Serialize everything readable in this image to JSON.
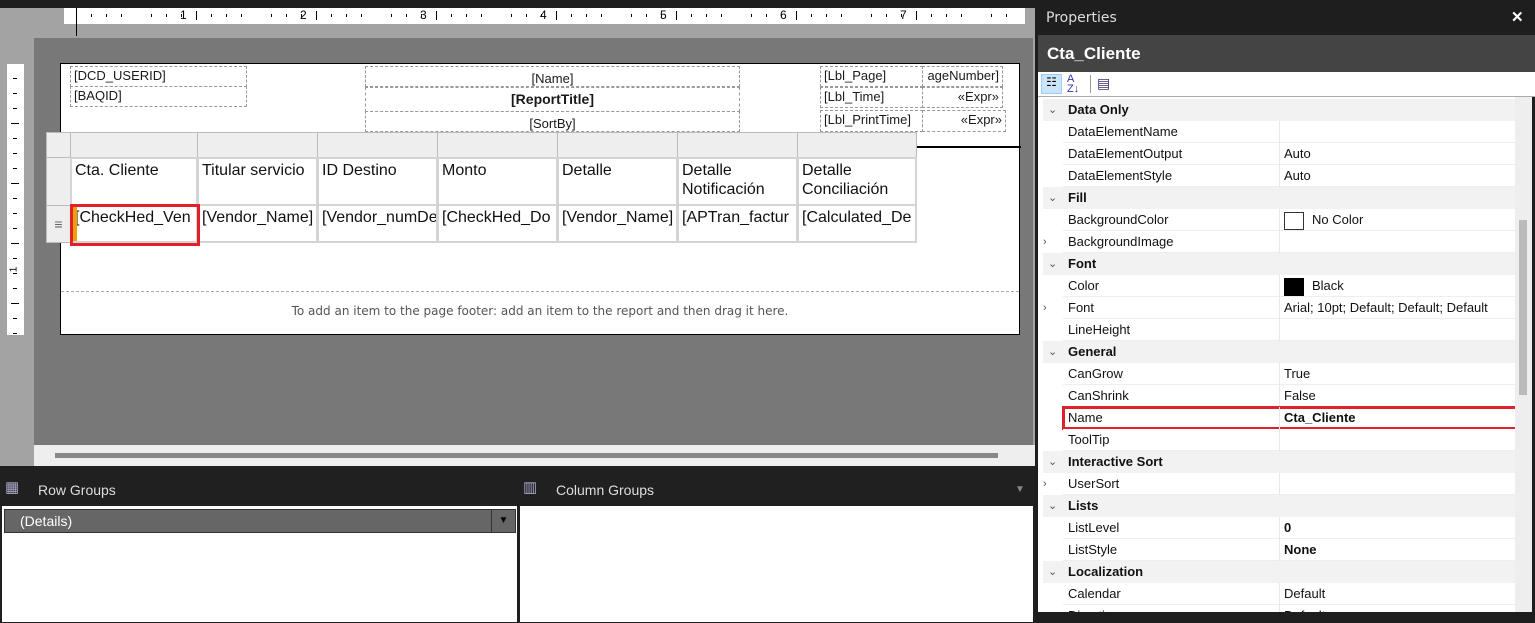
{
  "ruler": {
    "numbers": [
      "1",
      "2",
      "3",
      "4",
      "5",
      "6",
      "7"
    ],
    "vertical_number": "1"
  },
  "header": {
    "left": [
      "[DCD_USERID]",
      "[BAQID]"
    ],
    "center": [
      "[Name]",
      "[ReportTitle]",
      "[SortBy]"
    ],
    "right": [
      {
        "label": "[Lbl_Page]",
        "value": "ageNumber]"
      },
      {
        "label": "[Lbl_Time]",
        "value": "«Expr»"
      },
      {
        "label": "[Lbl_PrintTime]",
        "value": "«Expr»"
      }
    ]
  },
  "table": {
    "headers": [
      "Cta. Cliente",
      "Titular servicio",
      "ID Destino",
      "Monto",
      "Detalle",
      "Detalle Notificación",
      "Detalle Conciliación"
    ],
    "cells": [
      "[CheckHed_Ven",
      "[Vendor_Name]",
      "[Vendor_numDe",
      "[CheckHed_Do",
      "[Vendor_Name]",
      "[APTran_factur",
      "[Calculated_De"
    ],
    "row_handle": "≡"
  },
  "footer_hint": "To add an item to the page footer: add an item to the report and then drag it here.",
  "groups": {
    "row_title": "Row Groups",
    "column_title": "Column Groups",
    "row_items": [
      "(Details)"
    ]
  },
  "properties": {
    "title": "Properties",
    "close": "✕",
    "object_name": "Cta_Cliente",
    "sections": [
      {
        "name": "Data Only",
        "rows": [
          [
            "DataElementName",
            ""
          ],
          [
            "DataElementOutput",
            "Auto"
          ],
          [
            "DataElementStyle",
            "Auto"
          ]
        ]
      },
      {
        "name": "Fill",
        "rows": [
          [
            "BackgroundColor",
            "No Color"
          ],
          [
            "BackgroundImage",
            ""
          ]
        ]
      },
      {
        "name": "Font",
        "rows": [
          [
            "Color",
            "Black"
          ],
          [
            "Font",
            "Arial; 10pt; Default; Default; Default"
          ],
          [
            "LineHeight",
            ""
          ]
        ]
      },
      {
        "name": "General",
        "rows": [
          [
            "CanGrow",
            "True"
          ],
          [
            "CanShrink",
            "False"
          ],
          [
            "Name",
            "Cta_Cliente"
          ],
          [
            "ToolTip",
            ""
          ]
        ]
      },
      {
        "name": "Interactive Sort",
        "rows": [
          [
            "UserSort",
            ""
          ]
        ]
      },
      {
        "name": "Lists",
        "rows": [
          [
            "ListLevel",
            "0"
          ],
          [
            "ListStyle",
            "None"
          ]
        ]
      },
      {
        "name": "Localization",
        "rows": [
          [
            "Calendar",
            "Default"
          ],
          [
            "Direction",
            "Default"
          ]
        ]
      }
    ]
  },
  "colors": {
    "selection": "#e0202a",
    "handle": "#f0a000"
  }
}
